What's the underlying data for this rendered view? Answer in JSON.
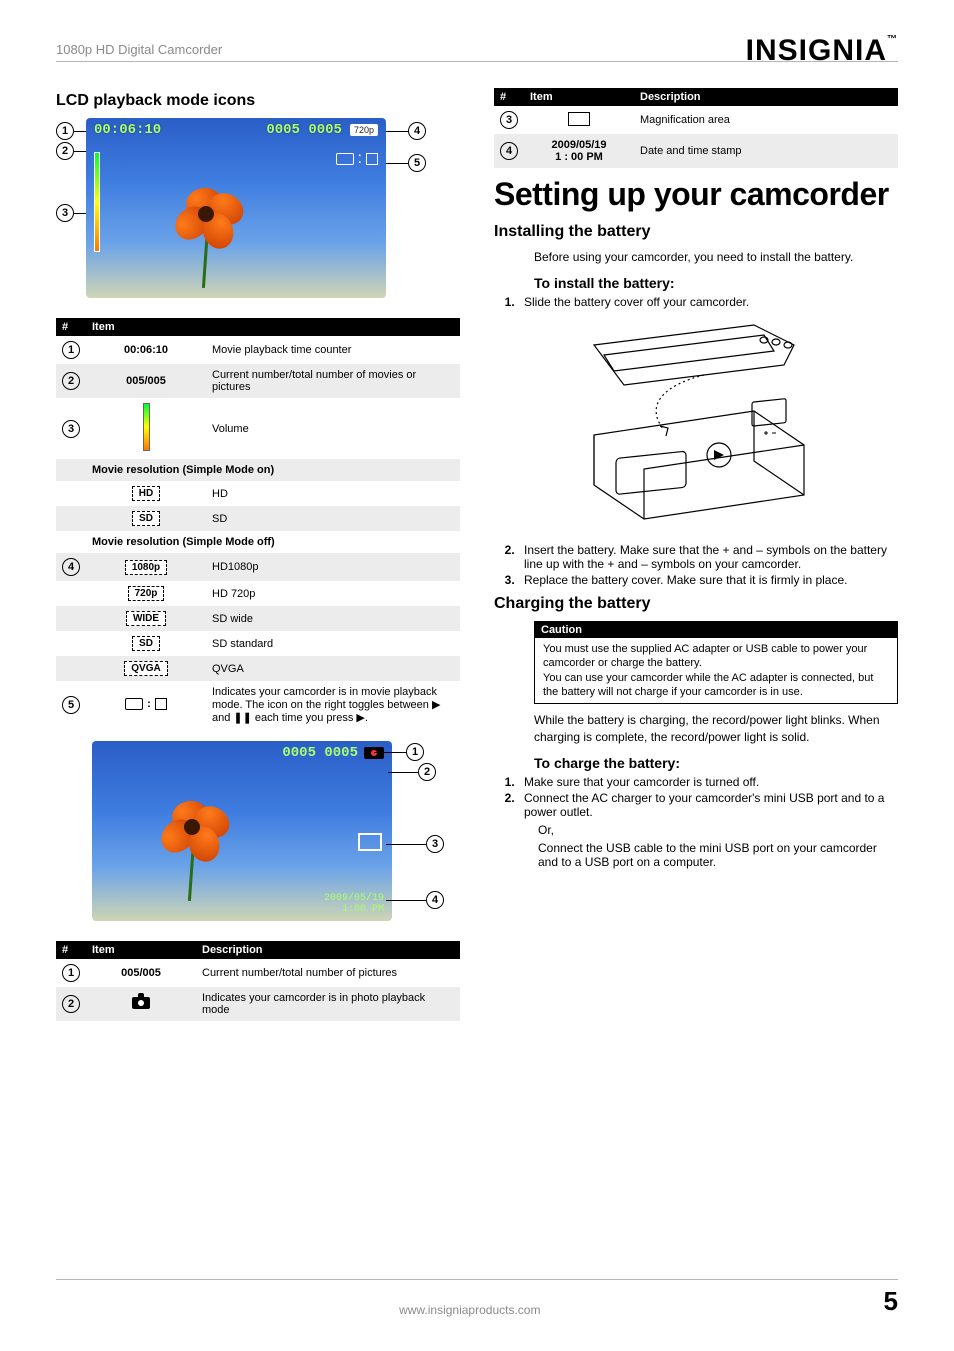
{
  "header": {
    "running_head": "1080p HD Digital Camcorder",
    "brand": "INSIGNIA",
    "brand_tm": "™"
  },
  "left": {
    "h2": "LCD playback mode icons",
    "lcd": {
      "time": "00:06:10",
      "count": "0005 0005",
      "chip": "720p",
      "callouts": {
        "c1": "1",
        "c2": "2",
        "c3": "3",
        "c4": "4",
        "c5": "5"
      }
    },
    "table1_head": {
      "num": "#",
      "item": "Item"
    },
    "table1": [
      {
        "n": "1",
        "item": "00:06:10",
        "desc": "Movie playback time counter"
      },
      {
        "n": "2",
        "item": "005/005",
        "desc": "Current number/total number of movies or pictures"
      },
      {
        "n": "3",
        "item": "VOL",
        "desc": "Volume"
      }
    ],
    "sec1": "Movie resolution (Simple Mode on)",
    "table1b": [
      {
        "box": "HD",
        "desc": "HD"
      },
      {
        "box": "SD",
        "desc": "SD"
      }
    ],
    "sec2": "Movie resolution (Simple Mode off)",
    "table1c_n": "4",
    "table1c": [
      {
        "box": "1080p",
        "desc": "HD1080p"
      },
      {
        "box": "720p",
        "desc": "HD 720p"
      },
      {
        "box": "WIDE",
        "desc": "SD wide"
      },
      {
        "box": "SD",
        "desc": "SD standard"
      },
      {
        "box": "QVGA",
        "desc": "QVGA"
      }
    ],
    "table1d_n": "5",
    "table1d_desc": "Indicates your camcorder is in movie playback mode. The icon on the right toggles between ▶ and ❚❚ each time you press ▶.",
    "lcd2": {
      "count": "0005 0005",
      "stamp_date": "2009/05/19",
      "stamp_time": "1:00 PM",
      "callouts": {
        "c1": "1",
        "c2": "2",
        "c3": "3",
        "c4": "4"
      }
    },
    "table2_head": {
      "num": "#",
      "item": "Item",
      "desc": "Description"
    },
    "table2": [
      {
        "n": "1",
        "item": "005/005",
        "desc": "Current number/total number of pictures"
      },
      {
        "n": "2",
        "item": "CAM",
        "desc": "Indicates your camcorder is in photo playback mode"
      }
    ]
  },
  "right": {
    "table3_head": {
      "num": "#",
      "item": "Item",
      "desc": "Description"
    },
    "table3": [
      {
        "n": "3",
        "desc": "Magnification area"
      },
      {
        "n": "4",
        "item1": "2009/05/19",
        "item2": "1 : 00 PM",
        "desc": "Date and time stamp"
      }
    ],
    "h1": "Setting up your camcorder",
    "install_h": "Installing the battery",
    "install_intro": "Before using your camcorder, you need to install the battery.",
    "install_sub": "To install the battery:",
    "install_steps": {
      "s1": "Slide the battery cover off your camcorder.",
      "s2": "Insert the battery. Make sure that the + and – symbols on the battery line up with the + and – symbols on your camcorder.",
      "s3": "Replace the battery cover. Make sure that it is firmly in place."
    },
    "charge_h": "Charging the battery",
    "caution_label": "Caution",
    "caution_p1": "You must use the supplied AC adapter or USB cable to power your camcorder or charge the battery.",
    "caution_p2": "You can use your camcorder while the AC adapter is connected, but the battery will not charge if your camcorder is in use.",
    "charge_intro": "While the battery is charging, the record/power light blinks. When charging is complete, the record/power light is solid.",
    "charge_sub": "To charge the battery:",
    "charge_s1": "Make sure that your camcorder is turned off.",
    "charge_s2": "Connect the AC charger to your camcorder's mini USB port and to a power outlet.",
    "charge_or": "Or,",
    "charge_s2b": "Connect the USB cable to the mini USB port on your camcorder and to a USB port on a computer."
  },
  "footer": {
    "url": "www.insigniaproducts.com",
    "page": "5"
  }
}
